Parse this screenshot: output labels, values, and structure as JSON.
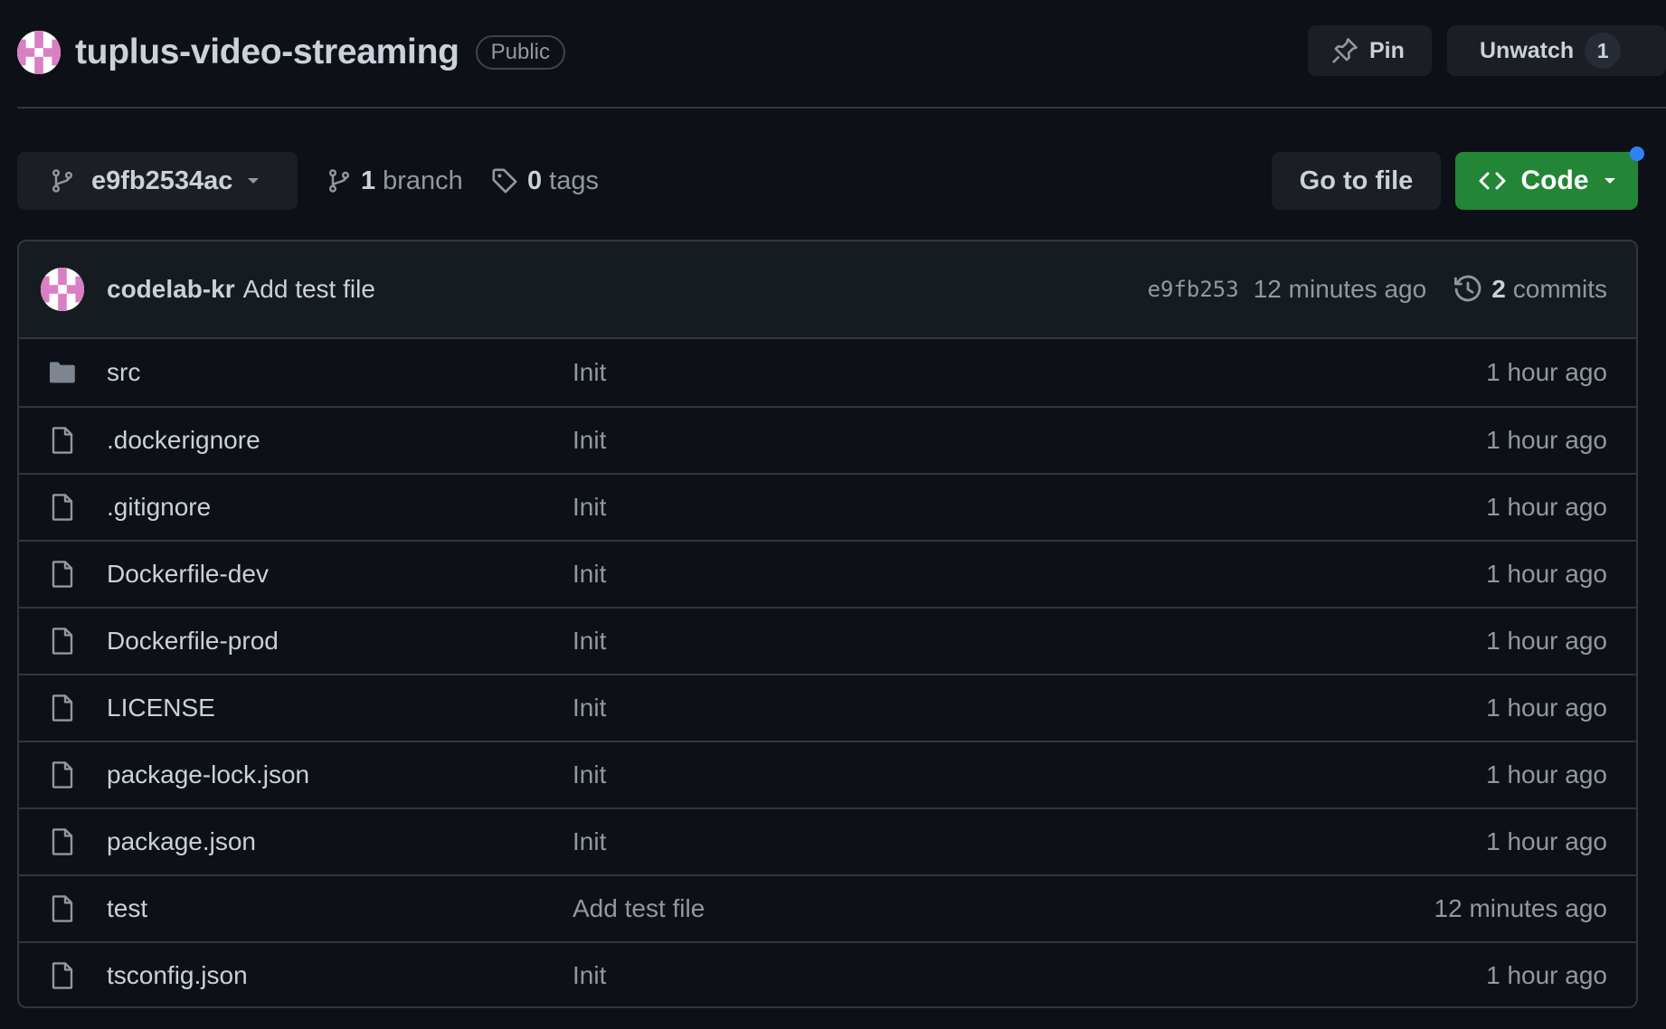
{
  "repo": {
    "name": "tuplus-video-streaming",
    "visibility": "Public"
  },
  "header_actions": {
    "pin_label": "Pin",
    "watch_label": "Unwatch",
    "watch_count": "1"
  },
  "toolbar": {
    "branch_name": "e9fb2534ac",
    "branches_count": "1",
    "branches_label": "branch",
    "tags_count": "0",
    "tags_label": "tags",
    "goto_file_label": "Go to file",
    "code_label": "Code"
  },
  "latest_commit": {
    "author": "codelab-kr",
    "message": "Add test file",
    "sha": "e9fb253",
    "time": "12 minutes ago",
    "commits_count": "2",
    "commits_label": "commits"
  },
  "files": [
    {
      "name": "src",
      "type": "folder",
      "commit": "Init",
      "age": "1 hour ago"
    },
    {
      "name": ".dockerignore",
      "type": "file",
      "commit": "Init",
      "age": "1 hour ago"
    },
    {
      "name": ".gitignore",
      "type": "file",
      "commit": "Init",
      "age": "1 hour ago"
    },
    {
      "name": "Dockerfile-dev",
      "type": "file",
      "commit": "Init",
      "age": "1 hour ago"
    },
    {
      "name": "Dockerfile-prod",
      "type": "file",
      "commit": "Init",
      "age": "1 hour ago"
    },
    {
      "name": "LICENSE",
      "type": "file",
      "commit": "Init",
      "age": "1 hour ago"
    },
    {
      "name": "package-lock.json",
      "type": "file",
      "commit": "Init",
      "age": "1 hour ago"
    },
    {
      "name": "package.json",
      "type": "file",
      "commit": "Init",
      "age": "1 hour ago"
    },
    {
      "name": "test",
      "type": "file",
      "commit": "Add test file",
      "age": "12 minutes ago"
    },
    {
      "name": "tsconfig.json",
      "type": "file",
      "commit": "Init",
      "age": "1 hour ago"
    }
  ],
  "colors": {
    "background": "#0d1117",
    "accent_green": "#238636",
    "notification_blue": "#2f81f7",
    "avatar_pink": "#d97fc4"
  }
}
